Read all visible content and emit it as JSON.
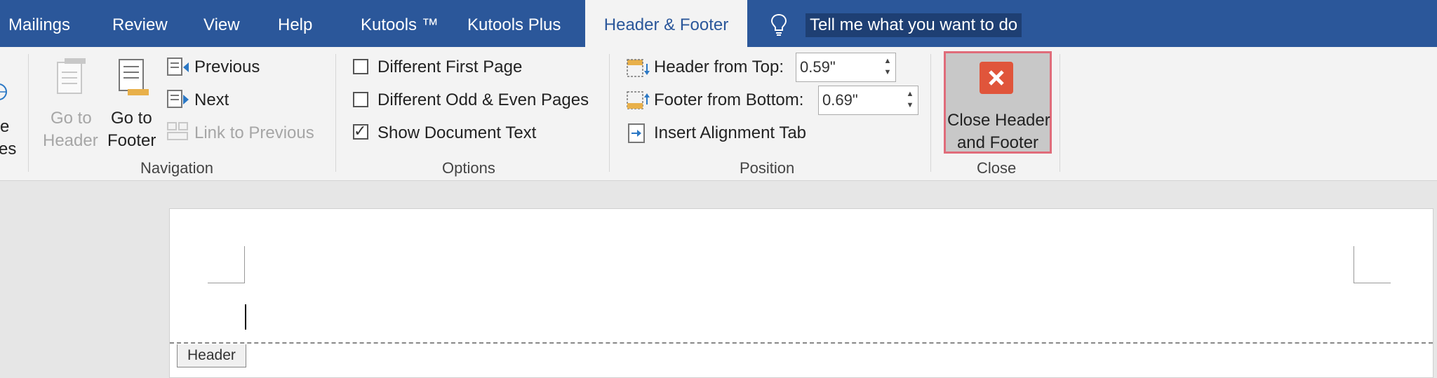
{
  "tabs": [
    {
      "label": "Mailings"
    },
    {
      "label": "Review"
    },
    {
      "label": "View"
    },
    {
      "label": "Help"
    },
    {
      "label": "Kutools ™"
    },
    {
      "label": "Kutools Plus"
    },
    {
      "label": "Header & Footer"
    }
  ],
  "tell_me": "Tell me what you want to do",
  "ribbon": {
    "cutoff_group": {
      "line1": "e",
      "line2": "es"
    },
    "navigation": {
      "go_to_header": {
        "line1": "Go to",
        "line2": "Header"
      },
      "go_to_footer": {
        "line1": "Go to",
        "line2": "Footer"
      },
      "previous": "Previous",
      "next": "Next",
      "link_to_previous": "Link to Previous",
      "label": "Navigation"
    },
    "options": {
      "different_first_page": "Different First Page",
      "different_odd_even": "Different Odd & Even Pages",
      "show_document_text": "Show Document Text",
      "checked": [
        false,
        false,
        true
      ],
      "label": "Options"
    },
    "position": {
      "header_from_top_label": "Header from Top:",
      "header_from_top_value": "0.59\"",
      "footer_from_bottom_label": "Footer from Bottom:",
      "footer_from_bottom_value": "0.69\"",
      "insert_alignment_tab": "Insert Alignment Tab",
      "label": "Position"
    },
    "close": {
      "line1": "Close Header",
      "line2": "and Footer",
      "label": "Close"
    }
  },
  "document": {
    "header_tag": "Header"
  },
  "colors": {
    "tabbar": "#2b579a",
    "close_icon": "#e0553b",
    "highlight_border": "#e06c7a"
  }
}
